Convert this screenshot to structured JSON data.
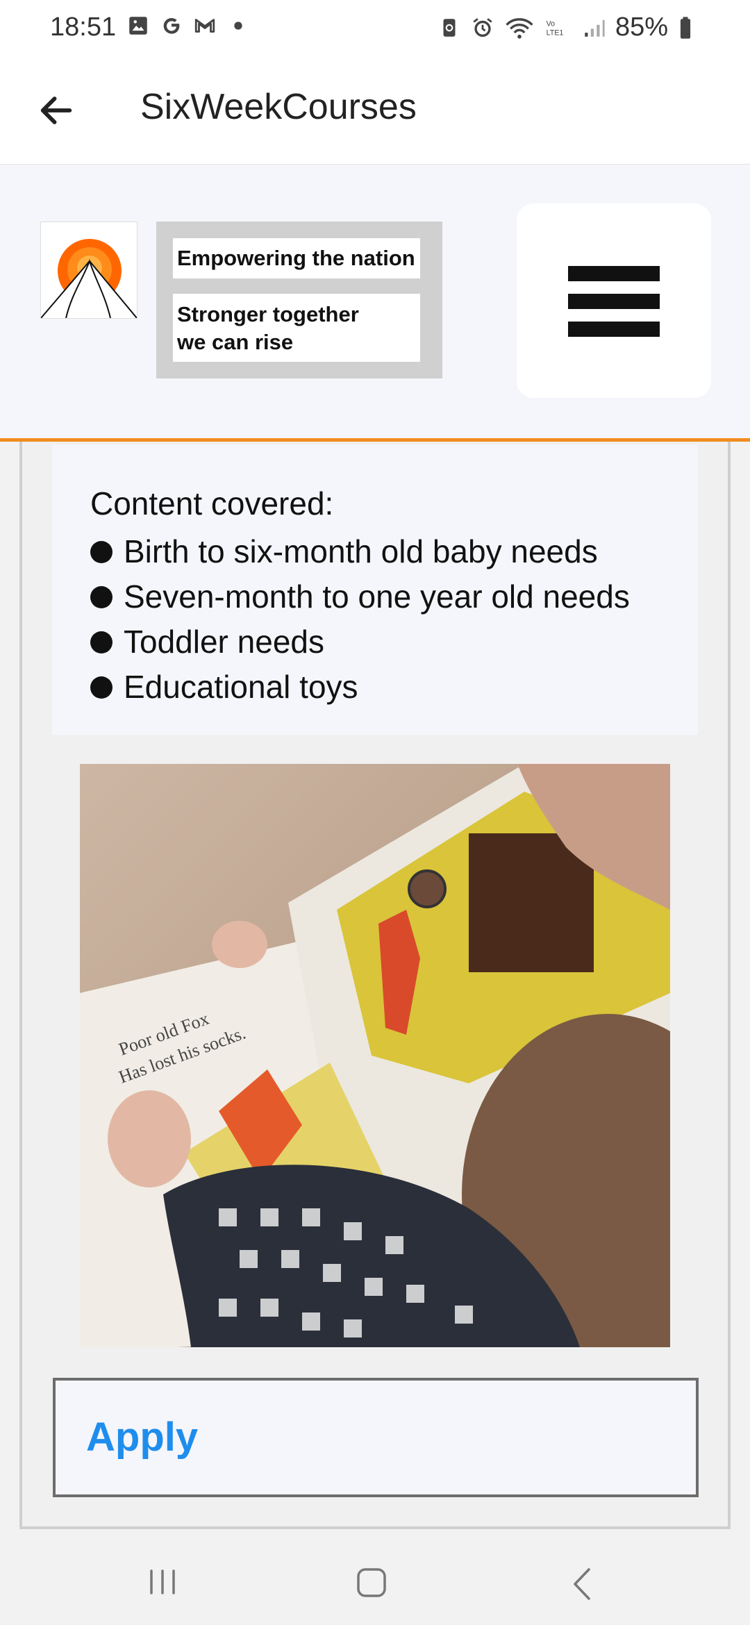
{
  "status_bar": {
    "time": "18:51",
    "battery": "85%",
    "left_icons": [
      "gallery-icon",
      "google-icon",
      "gmail-icon",
      "dot-icon"
    ],
    "right_icons": [
      "sync-icon",
      "alarm-icon",
      "wifi-icon",
      "volte-icon",
      "signal-icon",
      "battery-icon"
    ]
  },
  "app_bar": {
    "title": "SixWeekCourses"
  },
  "header": {
    "tagline_primary": "Empowering the nation",
    "tagline_secondary": "Stronger together\nwe can rise"
  },
  "content": {
    "heading": "Content covered:",
    "items": [
      "Birth to six-month old baby needs",
      "Seven-month to one year old needs",
      "Toddler needs",
      "Educational toys"
    ]
  },
  "actions": {
    "apply_label": "Apply"
  },
  "colors": {
    "accent_orange": "#f08c1e",
    "link_blue": "#1f8ded"
  }
}
